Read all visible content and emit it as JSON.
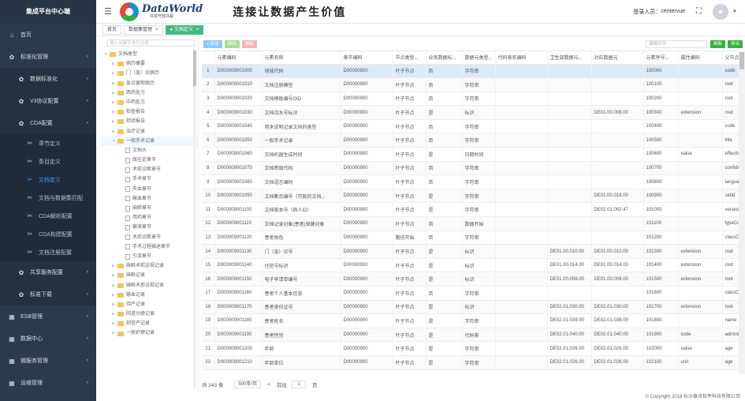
{
  "app_title": "集成平台中心端",
  "header": {
    "logo_main": "DataWorld",
    "logo_sub": "共享开放共赢",
    "slogan": "连接让数据产生价值",
    "user_label": "登录人员：",
    "user": "centervue"
  },
  "sidebar": {
    "items": [
      {
        "label": "首页",
        "icon": "home-icon",
        "level": 1
      },
      {
        "label": "标准化管理",
        "icon": "gear-icon",
        "level": 1
      },
      {
        "label": "数据标准化",
        "icon": "gear-icon",
        "level": 2
      },
      {
        "label": "V3协议配置",
        "icon": "gear-icon",
        "level": 2
      },
      {
        "label": "CDA配置",
        "icon": "gear-icon",
        "level": 2
      },
      {
        "label": "章节定义",
        "icon": "tools-icon",
        "level": 3
      },
      {
        "label": "条目定义",
        "icon": "tools-icon",
        "level": 3
      },
      {
        "label": "文档定义",
        "icon": "tools-icon",
        "level": 3,
        "active": true
      },
      {
        "label": "文档与数据集匹配",
        "icon": "tools-icon",
        "level": 3
      },
      {
        "label": "CDA解析配置",
        "icon": "tools-icon",
        "level": 3
      },
      {
        "label": "CDA构建配置",
        "icon": "tools-icon",
        "level": 3
      },
      {
        "label": "文档注册配置",
        "icon": "tools-icon",
        "level": 3
      },
      {
        "label": "共享服务配置",
        "icon": "gear-icon",
        "level": 2
      },
      {
        "label": "标准下载",
        "icon": "gear-icon",
        "level": 2
      },
      {
        "label": "ESB管理",
        "icon": "grid-icon",
        "level": 1
      },
      {
        "label": "数据中心",
        "icon": "grid-icon",
        "level": 1
      },
      {
        "label": "微服务管理",
        "icon": "grid-icon",
        "level": 1
      },
      {
        "label": "运维管理",
        "icon": "grid-icon",
        "level": 1
      },
      {
        "label": "其它管理",
        "icon": "grid-icon",
        "level": 1
      }
    ]
  },
  "tabs": [
    {
      "label": "首页"
    },
    {
      "label": "数据集管理"
    },
    {
      "label": "文档定义",
      "active": true
    }
  ],
  "tree": {
    "search_placeholder": "输入关键字进行过滤",
    "nodes": [
      {
        "label": "文档类型",
        "depth": 0,
        "type": "folder",
        "open": true
      },
      {
        "label": "病历概要",
        "depth": 1,
        "type": "folder"
      },
      {
        "label": "门（急）诊病历",
        "depth": 1,
        "type": "folder"
      },
      {
        "label": "急诊留观病历",
        "depth": 1,
        "type": "folder"
      },
      {
        "label": "西药处方",
        "depth": 1,
        "type": "folder"
      },
      {
        "label": "中药处方",
        "depth": 1,
        "type": "folder"
      },
      {
        "label": "检查报告",
        "depth": 1,
        "type": "folder"
      },
      {
        "label": "检验报告",
        "depth": 1,
        "type": "folder"
      },
      {
        "label": "治疗记录",
        "depth": 1,
        "type": "folder"
      },
      {
        "label": "一般手术记录",
        "depth": 1,
        "type": "folder",
        "open": true,
        "selected": true
      },
      {
        "label": "文档头",
        "depth": 2,
        "type": "doc"
      },
      {
        "label": "既往史章节",
        "depth": 2,
        "type": "doc"
      },
      {
        "label": "术前诊断章节",
        "depth": 2,
        "type": "doc"
      },
      {
        "label": "手术章节",
        "depth": 2,
        "type": "doc"
      },
      {
        "label": "失血章节",
        "depth": 2,
        "type": "doc"
      },
      {
        "label": "输血章节",
        "depth": 2,
        "type": "doc"
      },
      {
        "label": "麻醉章节",
        "depth": 2,
        "type": "doc"
      },
      {
        "label": "用药章节",
        "depth": 2,
        "type": "doc"
      },
      {
        "label": "输液章节",
        "depth": 2,
        "type": "doc"
      },
      {
        "label": "术后诊断章节",
        "depth": 2,
        "type": "doc"
      },
      {
        "label": "手术过程描述章节",
        "depth": 2,
        "type": "doc"
      },
      {
        "label": "引流章节",
        "depth": 2,
        "type": "doc"
      },
      {
        "label": "麻醉术前访视记录",
        "depth": 1,
        "type": "folder"
      },
      {
        "label": "麻醉记录",
        "depth": 1,
        "type": "folder"
      },
      {
        "label": "麻醉术后访视记录",
        "depth": 1,
        "type": "folder"
      },
      {
        "label": "输血记录",
        "depth": 1,
        "type": "folder"
      },
      {
        "label": "待产记录",
        "depth": 1,
        "type": "folder"
      },
      {
        "label": "阴道分娩记录",
        "depth": 1,
        "type": "folder"
      },
      {
        "label": "剖宫产记录",
        "depth": 1,
        "type": "folder"
      },
      {
        "label": "一般护理记录",
        "depth": 1,
        "type": "folder"
      }
    ]
  },
  "toolbar": {
    "add": "+ 新增",
    "edit": "修改",
    "delete": "删除",
    "search_placeholder": "模糊名称",
    "refresh": "刷新",
    "export": "导出"
  },
  "table": {
    "columns": [
      "",
      "元素编码",
      "元素名称",
      "章节编码",
      "节点类型...",
      "业务数据标...",
      "数据元类型...",
      "代码表名编码",
      "卫生部数据元...",
      "对应数据元",
      "元素序号...",
      "属性编码",
      "父节点编码"
    ],
    "rows": [
      [
        "1",
        "D000009001000",
        "地域代码",
        "D00000900",
        "叶子节点",
        "否",
        "字符串",
        "",
        "",
        "",
        "100000",
        "",
        "code"
      ],
      [
        "2",
        "D000009001010",
        "文档注册模型",
        "D00000900",
        "叶子节点",
        "否",
        "字符串",
        "",
        "",
        "",
        "100100",
        "",
        "root"
      ],
      [
        "3",
        "D000009001020",
        "文档模板编号OID",
        "D00000900",
        "叶子节点",
        "否",
        "字符串",
        "",
        "",
        "",
        "100200",
        "",
        "root"
      ],
      [
        "4",
        "D000009001030",
        "文档流水号标识",
        "D00000900",
        "叶子节点",
        "是",
        "标识",
        "",
        "",
        "DE01.00.008.00",
        "100300",
        "extension",
        "root"
      ],
      [
        "5",
        "D000009001040",
        "用来说明记录文档的类型",
        "D00000900",
        "叶子节点",
        "否",
        "字符串",
        "",
        "",
        "",
        "100400",
        "",
        "code"
      ],
      [
        "6",
        "D000009001050",
        "一般手术记录",
        "D00000900",
        "叶子节点",
        "否",
        "字符串",
        "",
        "",
        "",
        "100500",
        "",
        "title"
      ],
      [
        "7",
        "D000009001060",
        "文档机器生成时间",
        "D00000900",
        "叶子节点",
        "是",
        "日期时间",
        "",
        "",
        "",
        "100600",
        "value",
        "effectiveTime"
      ],
      [
        "8",
        "D000009001070",
        "文档密级代码",
        "D00000900",
        "叶子节点",
        "否",
        "字符串",
        "",
        "",
        "",
        "100700",
        "",
        "confidentiality"
      ],
      [
        "9",
        "D000009001080",
        "文档语言编码",
        "D00000900",
        "叶子节点",
        "否",
        "字符串",
        "",
        "",
        "",
        "100800",
        "",
        "languageCode"
      ],
      [
        "10",
        "D000009001090",
        "文档集合编号（可能的文档...",
        "D00000900",
        "叶子节点",
        "是",
        "字符串",
        "",
        "",
        "DE01.00.018.00",
        "100900",
        "",
        "setId"
      ],
      [
        "11",
        "D000009001100",
        "文档版本号（病人ID）",
        "D00000900",
        "叶子节点",
        "是",
        "字符串",
        "",
        "",
        "DE02.01.062.47",
        "101000",
        "",
        "versionNumber"
      ],
      [
        "12",
        "D000009001110",
        "文档记录对象(患者)保健对象",
        "D00000900",
        "叶子节点",
        "否",
        "数据开始",
        "",
        "",
        "",
        "101100",
        "",
        "typeCode"
      ],
      [
        "13",
        "D000009001120",
        "患者角色",
        "D00000900",
        "路径开始",
        "否",
        "字符串",
        "",
        "",
        "",
        "101200",
        "",
        "classCode"
      ],
      [
        "14",
        "D000009001130",
        "门（急）诊号",
        "D00000900",
        "叶子节点",
        "是",
        "标识",
        "",
        "DE01.00.010.00",
        "DE01.00.010.00",
        "101300",
        "extension",
        "root"
      ],
      [
        "15",
        "D000009001140",
        "住院号标识",
        "D00000900",
        "叶子节点",
        "是",
        "标识",
        "",
        "DE01.00.014.00",
        "DE01.00.014.00",
        "101400",
        "extension",
        "root"
      ],
      [
        "16",
        "D000009001150",
        "电子申请单编号",
        "D00000900",
        "叶子节点",
        "是",
        "标识",
        "",
        "DE01.00.008.00",
        "DE01.00.008.00",
        "101500",
        "extension",
        "root"
      ],
      [
        "17",
        "D000009001160",
        "患者个人基本信息",
        "D00000900",
        "叶子节点",
        "否",
        "字符串",
        "",
        "",
        "",
        "101600",
        "",
        "classCode"
      ],
      [
        "18",
        "D000009001170",
        "患者身份证号",
        "D00000900",
        "叶子节点",
        "是",
        "标识",
        "",
        "DE02.01.030.00",
        "DE02.01.030.00",
        "101700",
        "extension",
        "root"
      ],
      [
        "19",
        "D000009001180",
        "患者姓名",
        "D00000900",
        "叶子节点",
        "是",
        "字符串",
        "",
        "DE02.01.039.00",
        "DE02.01.039.00",
        "101800",
        "",
        "name"
      ],
      [
        "20",
        "D000009001190",
        "患者性别",
        "D00000900",
        "叶子节点",
        "是",
        "代码表",
        "",
        "DE02.01.040.00",
        "DE02.01.040.00",
        "101900",
        "code",
        "administrativeGenderCode"
      ],
      [
        "21",
        "D000009001200",
        "年龄",
        "D00000900",
        "叶子节点",
        "是",
        "字符串",
        "",
        "DE02.01.026.00",
        "DE02.01.026.00",
        "102000",
        "value",
        "age"
      ],
      [
        "22",
        "D000009001210",
        "年龄单位",
        "D00000900",
        "叶子节点",
        "是",
        "字符串",
        "",
        "DE02.01.026.00",
        "DE02.01.026.00",
        "102100",
        "unit",
        "age"
      ]
    ]
  },
  "footer": {
    "total": "共 243 条",
    "page_size": "500条/页",
    "prev": "前往",
    "page": "1",
    "unit": "页"
  },
  "copyright": "© Copyright 2018 长沙泰讯软件科技有限公司"
}
